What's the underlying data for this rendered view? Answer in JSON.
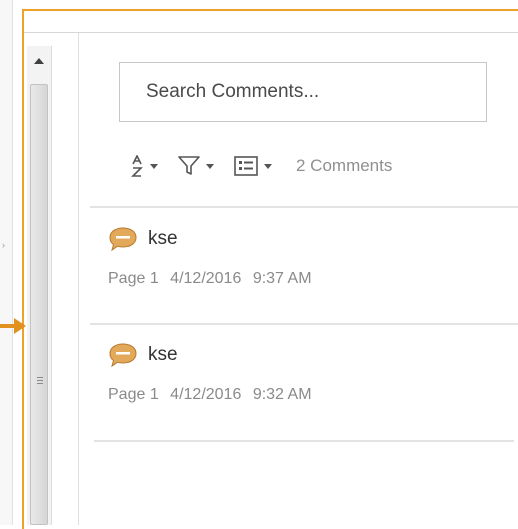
{
  "search": {
    "placeholder": "Search Comments..."
  },
  "toolbar": {
    "sort_icon": "sort-az-icon",
    "filter_icon": "filter-icon",
    "options_icon": "list-options-icon",
    "comment_count": "2 Comments"
  },
  "comments": [
    {
      "author": "kse",
      "page": "Page 1",
      "date": "4/12/2016",
      "time": "9:37 AM"
    },
    {
      "author": "kse",
      "page": "Page 1",
      "date": "4/12/2016",
      "time": "9:32 AM"
    }
  ],
  "colors": {
    "highlight": "#f0a12a",
    "comment_icon": "#e2a95a"
  }
}
